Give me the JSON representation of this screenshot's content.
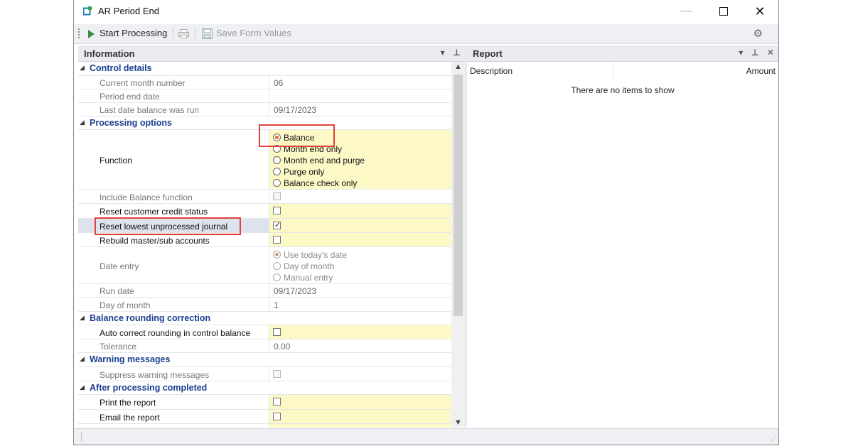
{
  "window": {
    "title": "AR Period End"
  },
  "toolbar": {
    "start_label": "Start Processing",
    "save_label": "Save Form Values"
  },
  "info_panel": {
    "title": "Information"
  },
  "report_panel": {
    "title": "Report",
    "columns": [
      "Description",
      "Amount"
    ],
    "empty_text": "There are no items to show"
  },
  "categories": {
    "control": "Control details",
    "processing": "Processing options",
    "rounding": "Balance rounding correction",
    "warnings": "Warning messages",
    "after": "After processing completed"
  },
  "props": {
    "current_month_number": {
      "label": "Current month number",
      "value": "06"
    },
    "period_end_date": {
      "label": "Period end date",
      "value": ""
    },
    "last_balance_date": {
      "label": "Last date balance was run",
      "value": "09/17/2023"
    },
    "function": {
      "label": "Function",
      "options": [
        "Balance",
        "Month end only",
        "Month end and purge",
        "Purge only",
        "Balance check only"
      ],
      "selected": "Balance"
    },
    "include_balance": {
      "label": "Include Balance function",
      "checked": false
    },
    "reset_credit": {
      "label": "Reset customer credit status",
      "checked": false
    },
    "reset_journal": {
      "label": "Reset lowest unprocessed journal",
      "checked": true
    },
    "rebuild_master": {
      "label": "Rebuild master/sub accounts",
      "checked": false
    },
    "date_entry": {
      "label": "Date entry",
      "options": [
        "Use today's date",
        "Day of month",
        "Manual entry"
      ],
      "selected": "Use today's date"
    },
    "run_date": {
      "label": "Run date",
      "value": "09/17/2023"
    },
    "day_of_month": {
      "label": "Day of month",
      "value": "1"
    },
    "auto_correct": {
      "label": "Auto correct rounding in control balance",
      "checked": false
    },
    "tolerance": {
      "label": "Tolerance",
      "value": "0.00"
    },
    "suppress_warnings": {
      "label": "Suppress warning messages",
      "checked": false
    },
    "print_report": {
      "label": "Print the report",
      "checked": false
    },
    "email_report": {
      "label": "Email the report",
      "checked": false
    }
  }
}
